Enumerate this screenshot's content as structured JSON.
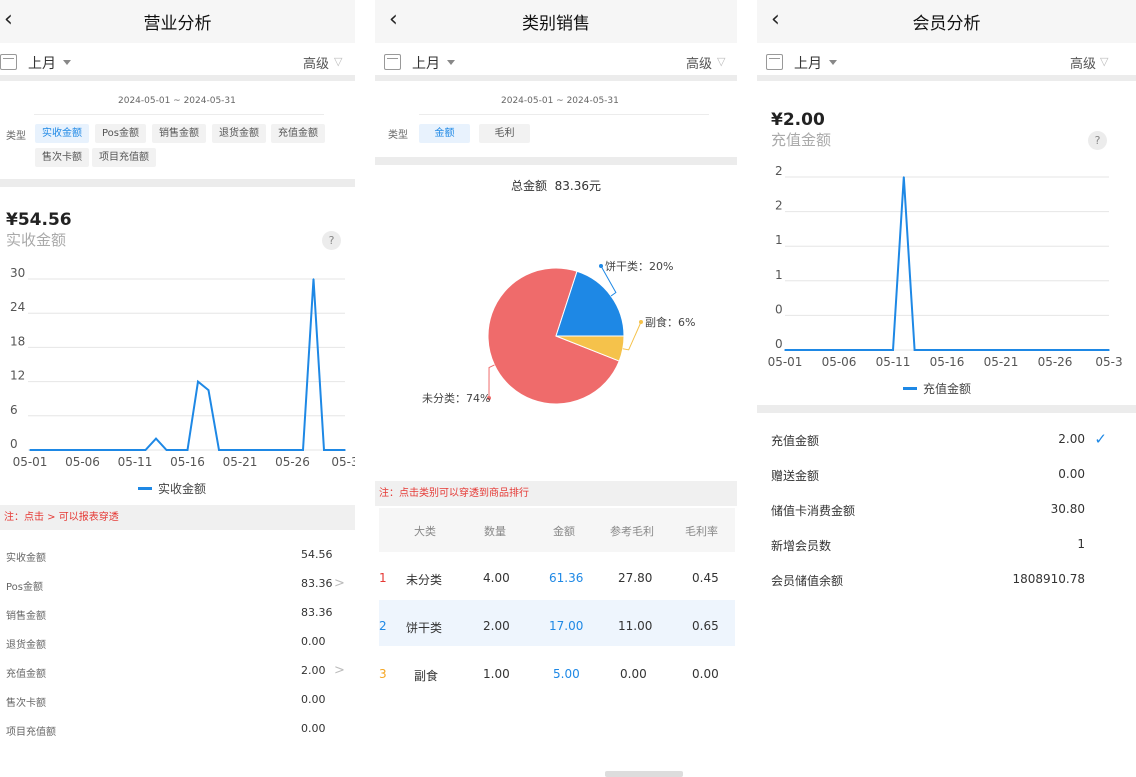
{
  "colors": {
    "accent": "#1e88e5",
    "red": "#ef6b6b",
    "yellow": "#f5c24b",
    "warn": "#e53935"
  },
  "icons": {
    "back": "chevron-left-icon",
    "calendar": "calendar-icon",
    "caret": "caret-down-icon",
    "filter": "filter-icon",
    "help": "question-icon",
    "chevron": "chevron-right-icon",
    "check": "check-icon"
  },
  "p1": {
    "title": "营业分析",
    "month": "上月",
    "advanced": "高级",
    "date_range": "2024-05-01 ~ 2024-05-31",
    "type_label": "类型",
    "chips": [
      "实收金额",
      "Pos金额",
      "销售金额",
      "退货金额",
      "充值金额",
      "售次卡额",
      "项目充值额"
    ],
    "amount": "¥54.56",
    "amount_label": "实收金额",
    "help": "?",
    "note": "注：点击 > 可以报表穿透",
    "rows": [
      {
        "label": "实收金额",
        "value": "54.56"
      },
      {
        "label": "Pos金额",
        "value": "83.36",
        "chevron": ">"
      },
      {
        "label": "销售金额",
        "value": "83.36"
      },
      {
        "label": "退货金额",
        "value": "0.00"
      },
      {
        "label": "充值金额",
        "value": "2.00",
        "chevron": ">"
      },
      {
        "label": "售次卡额",
        "value": "0.00"
      },
      {
        "label": "项目充值额",
        "value": "0.00"
      }
    ]
  },
  "p2": {
    "title": "类别销售",
    "month": "上月",
    "advanced": "高级",
    "date_range": "2024-05-01 ~ 2024-05-31",
    "type_label": "类型",
    "chips": [
      "金额",
      "毛利"
    ],
    "total_label": "总金额",
    "total_value": "83.36元",
    "note": "注：点击类别可以穿透到商品排行",
    "headers": [
      "大类",
      "数量",
      "金额",
      "参考毛利",
      "毛利率"
    ],
    "rows": [
      {
        "rank": "1",
        "name": "未分类",
        "qty": "4.00",
        "amount": "61.36",
        "profit": "27.80",
        "rate": "0.45"
      },
      {
        "rank": "2",
        "name": "饼干类",
        "qty": "2.00",
        "amount": "17.00",
        "profit": "11.00",
        "rate": "0.65"
      },
      {
        "rank": "3",
        "name": "副食",
        "qty": "1.00",
        "amount": "5.00",
        "profit": "0.00",
        "rate": "0.00"
      }
    ]
  },
  "p3": {
    "title": "会员分析",
    "month": "上月",
    "advanced": "高级",
    "amount": "¥2.00",
    "amount_label": "充值金额",
    "help": "?",
    "check": "✓",
    "rows": [
      {
        "label": "充值金额",
        "value": "2.00"
      },
      {
        "label": "赠送金额",
        "value": "0.00"
      },
      {
        "label": "储值卡消费金额",
        "value": "30.80"
      },
      {
        "label": "新增会员数",
        "value": "1"
      },
      {
        "label": "会员储值余额",
        "value": "1808910.78"
      }
    ]
  },
  "chart_data": [
    {
      "type": "line",
      "x_ticks": [
        "05-01",
        "05-06",
        "05-11",
        "05-16",
        "05-21",
        "05-26",
        "05-3"
      ],
      "y_ticks": [
        "0",
        "6",
        "12",
        "18",
        "24",
        "30"
      ],
      "ylim": [
        0,
        30
      ],
      "x": [
        1,
        2,
        3,
        4,
        5,
        6,
        7,
        8,
        9,
        10,
        11,
        12,
        13,
        14,
        15,
        16,
        17,
        18,
        19,
        20,
        21,
        22,
        23,
        24,
        25,
        26,
        27,
        28,
        29,
        30,
        31
      ],
      "series": [
        {
          "name": "实收金额",
          "values": [
            0,
            0,
            0,
            0,
            0,
            0,
            0,
            0,
            0,
            0,
            0,
            0,
            2,
            0,
            0,
            0,
            12,
            10.5,
            0,
            0,
            0,
            0,
            0,
            0,
            0,
            0,
            0,
            30,
            0,
            0,
            0
          ]
        }
      ],
      "grid": true,
      "legend": "bottom"
    },
    {
      "type": "pie",
      "slices": [
        {
          "label": "未分类",
          "pct": "74%",
          "value": 74,
          "color": "#ef6b6b"
        },
        {
          "label": "饼干类",
          "pct": "20%",
          "value": 20,
          "color": "#1e88e5"
        },
        {
          "label": "副食",
          "pct": "6%",
          "value": 6,
          "color": "#f5c24b"
        }
      ]
    },
    {
      "type": "line",
      "x_ticks": [
        "05-01",
        "05-06",
        "05-11",
        "05-16",
        "05-21",
        "05-26",
        "05-3"
      ],
      "y_ticks": [
        "0",
        "0",
        "1",
        "1",
        "2",
        "2"
      ],
      "ylim": [
        0,
        2
      ],
      "x": [
        1,
        2,
        3,
        4,
        5,
        6,
        7,
        8,
        9,
        10,
        11,
        12,
        13,
        14,
        15,
        16,
        17,
        18,
        19,
        20,
        21,
        22,
        23,
        24,
        25,
        26,
        27,
        28,
        29,
        30,
        31
      ],
      "series": [
        {
          "name": "充值金额",
          "values": [
            0,
            0,
            0,
            0,
            0,
            0,
            0,
            0,
            0,
            0,
            0,
            2,
            0,
            0,
            0,
            0,
            0,
            0,
            0,
            0,
            0,
            0,
            0,
            0,
            0,
            0,
            0,
            0,
            0,
            0,
            0
          ]
        }
      ],
      "grid": true,
      "legend": "bottom"
    }
  ]
}
